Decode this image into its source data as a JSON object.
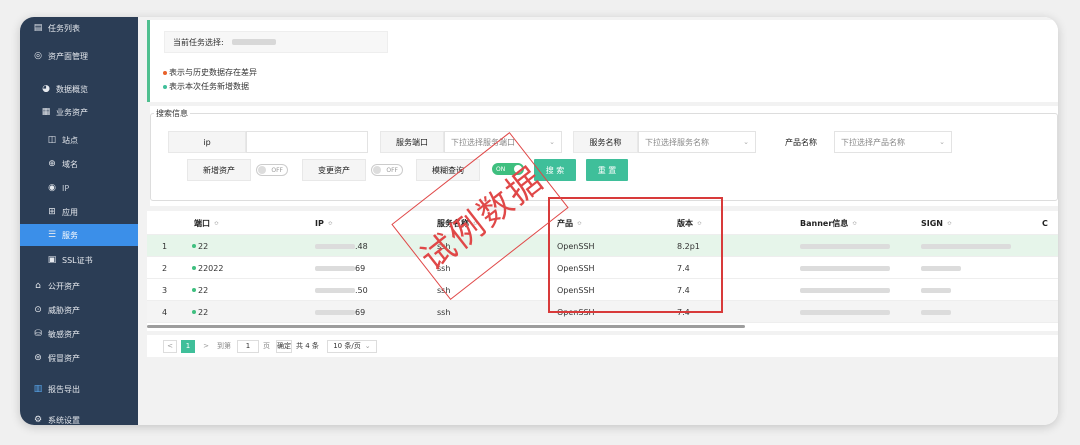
{
  "sidebar": {
    "items": [
      {
        "label": "任务列表",
        "icon": "task-list-icon"
      },
      {
        "label": "资产面管理",
        "icon": "target-icon"
      },
      {
        "label": "数据概览",
        "icon": "pie-chart-icon"
      },
      {
        "label": "业务资产",
        "icon": "server-icon"
      },
      {
        "label": "站点",
        "icon": "site-icon"
      },
      {
        "label": "域名",
        "icon": "globe-icon"
      },
      {
        "label": "IP",
        "icon": "ip-icon"
      },
      {
        "label": "应用",
        "icon": "apps-icon"
      },
      {
        "label": "服务",
        "icon": "service-icon"
      },
      {
        "label": "SSL证书",
        "icon": "certificate-icon"
      },
      {
        "label": "公开资产",
        "icon": "public-asset-icon"
      },
      {
        "label": "威胁资产",
        "icon": "threat-icon"
      },
      {
        "label": "敏感资产",
        "icon": "database-icon"
      },
      {
        "label": "假冒资产",
        "icon": "fake-asset-icon"
      },
      {
        "label": "报告导出",
        "icon": "report-icon"
      },
      {
        "label": "系统设置",
        "icon": "settings-icon"
      }
    ]
  },
  "task": {
    "label": "当前任务选择:"
  },
  "legend": {
    "diff": {
      "text": "表示与历史数据存在差异",
      "color": "#e8622c"
    },
    "new": {
      "text": "表示本次任务新增数据",
      "color": "#3fbf9a"
    }
  },
  "search": {
    "title": "搜索信息",
    "ip_label": "ip",
    "port_label": "服务端口",
    "port_placeholder": "下拉选择服务端口",
    "service_label": "服务名称",
    "service_placeholder": "下拉选择服务名称",
    "product_label": "产品名称",
    "product_placeholder": "下拉选择产品名称",
    "new_asset_label": "新增资产",
    "change_asset_label": "变更资产",
    "fuzzy_label": "模糊查询",
    "off_text": "OFF",
    "on_text": "ON",
    "search_button": "搜 索",
    "reset_button": "重 置"
  },
  "table": {
    "headers": [
      "端口",
      "IP",
      "服务名称",
      "产品",
      "版本",
      "Banner信息",
      "SIGN",
      "C"
    ],
    "rows": [
      {
        "idx": "1",
        "port": "22",
        "ip_suffix": ".48",
        "service": "ssh",
        "product": "OpenSSH",
        "version": "8.2p1"
      },
      {
        "idx": "2",
        "port": "22022",
        "ip_suffix": "69",
        "service": "ssh",
        "product": "OpenSSH",
        "version": "7.4"
      },
      {
        "idx": "3",
        "port": "22",
        "ip_suffix": ".50",
        "service": "ssh",
        "product": "OpenSSH",
        "version": "7.4"
      },
      {
        "idx": "4",
        "port": "22",
        "ip_suffix": "69",
        "service": "ssh",
        "product": "OpenSSH",
        "version": "7.4"
      }
    ]
  },
  "pager": {
    "prev": "<",
    "current": "1",
    "next": ">",
    "goto_label": "到第",
    "goto_value": "1",
    "page_unit": "页",
    "confirm": "确定",
    "total": "共 4 条",
    "page_size": "10 条/页"
  },
  "watermark": {
    "text": "试例数据"
  }
}
